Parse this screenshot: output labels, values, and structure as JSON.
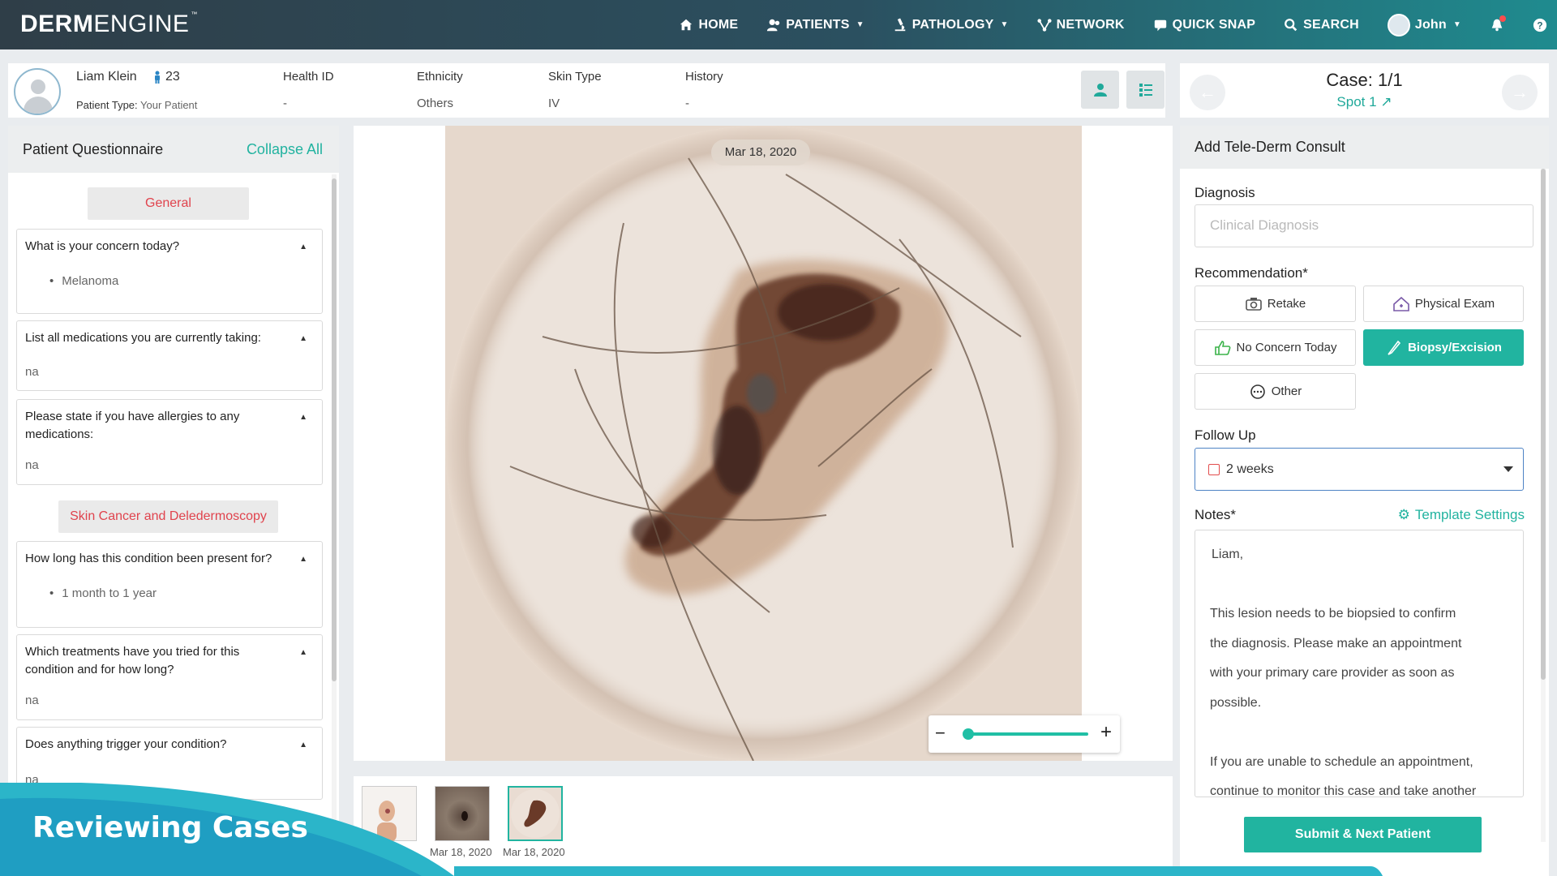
{
  "brand": {
    "logo_part1": "DERM",
    "logo_part2": "ENGINE",
    "tm": "™"
  },
  "nav": {
    "home": "HOME",
    "patients": "PATIENTS",
    "pathology": "PATHOLOGY",
    "network": "NETWORK",
    "quick_snap": "QUICK SNAP",
    "search": "SEARCH",
    "user": "John"
  },
  "patient": {
    "name": "Liam Klein",
    "age": "23",
    "type_label": "Patient Type:",
    "type_value": "Your Patient",
    "fields": [
      {
        "label": "Health ID",
        "value": "-"
      },
      {
        "label": "Ethnicity",
        "value": "Others"
      },
      {
        "label": "Skin Type",
        "value": "IV"
      },
      {
        "label": "History",
        "value": "-"
      }
    ]
  },
  "case": {
    "title": "Case: 1/1",
    "spot": "Spot 1"
  },
  "questionnaire": {
    "title": "Patient Questionnaire",
    "collapse": "Collapse All",
    "section1": "General",
    "section2": "Skin Cancer and Deledermoscopy",
    "questions": [
      {
        "q": "What is your concern today?",
        "a": "Melanoma"
      },
      {
        "q": "List all medications you are currently taking:",
        "a": "na"
      },
      {
        "q": "Please state if you have allergies to any medications:",
        "a": "na"
      },
      {
        "q": "How long has this condition been present for?",
        "a": "1 month to 1 year"
      },
      {
        "q": "Which treatments have you tried for this condition and for how long?",
        "a": "na"
      },
      {
        "q": "Does anything trigger your condition?",
        "a": "na"
      }
    ]
  },
  "viewer": {
    "date": "Mar 18, 2020"
  },
  "thumbnails": [
    {
      "label": ""
    },
    {
      "label": "Mar 18, 2020"
    },
    {
      "label": "Mar 18, 2020"
    }
  ],
  "consult": {
    "title": "Add Tele-Derm Consult",
    "diagnosis_label": "Diagnosis",
    "diagnosis_placeholder": "Clinical Diagnosis",
    "recommendation_label": "Recommendation*",
    "buttons": {
      "retake": "Retake",
      "physical_exam": "Physical Exam",
      "no_concern": "No Concern Today",
      "biopsy": "Biopsy/Excision",
      "other": "Other"
    },
    "follow_up_label": "Follow Up",
    "follow_up_value": "2 weeks",
    "notes_label": "Notes*",
    "template_settings": "Template Settings",
    "notes_lines": [
      "Liam,",
      "",
      "This lesion needs to be biopsied to confirm",
      "the diagnosis. Please make an appointment",
      "with your primary care provider as soon as",
      "possible.",
      "",
      "If you are unable to schedule an appointment,",
      "continue to monitor this case and take another"
    ],
    "submit": "Submit & Next Patient"
  },
  "caption": "Reviewing Cases",
  "colors": {
    "accent": "#21b4a0",
    "danger": "#e0434d",
    "nav_dark": "#2f3e48"
  }
}
